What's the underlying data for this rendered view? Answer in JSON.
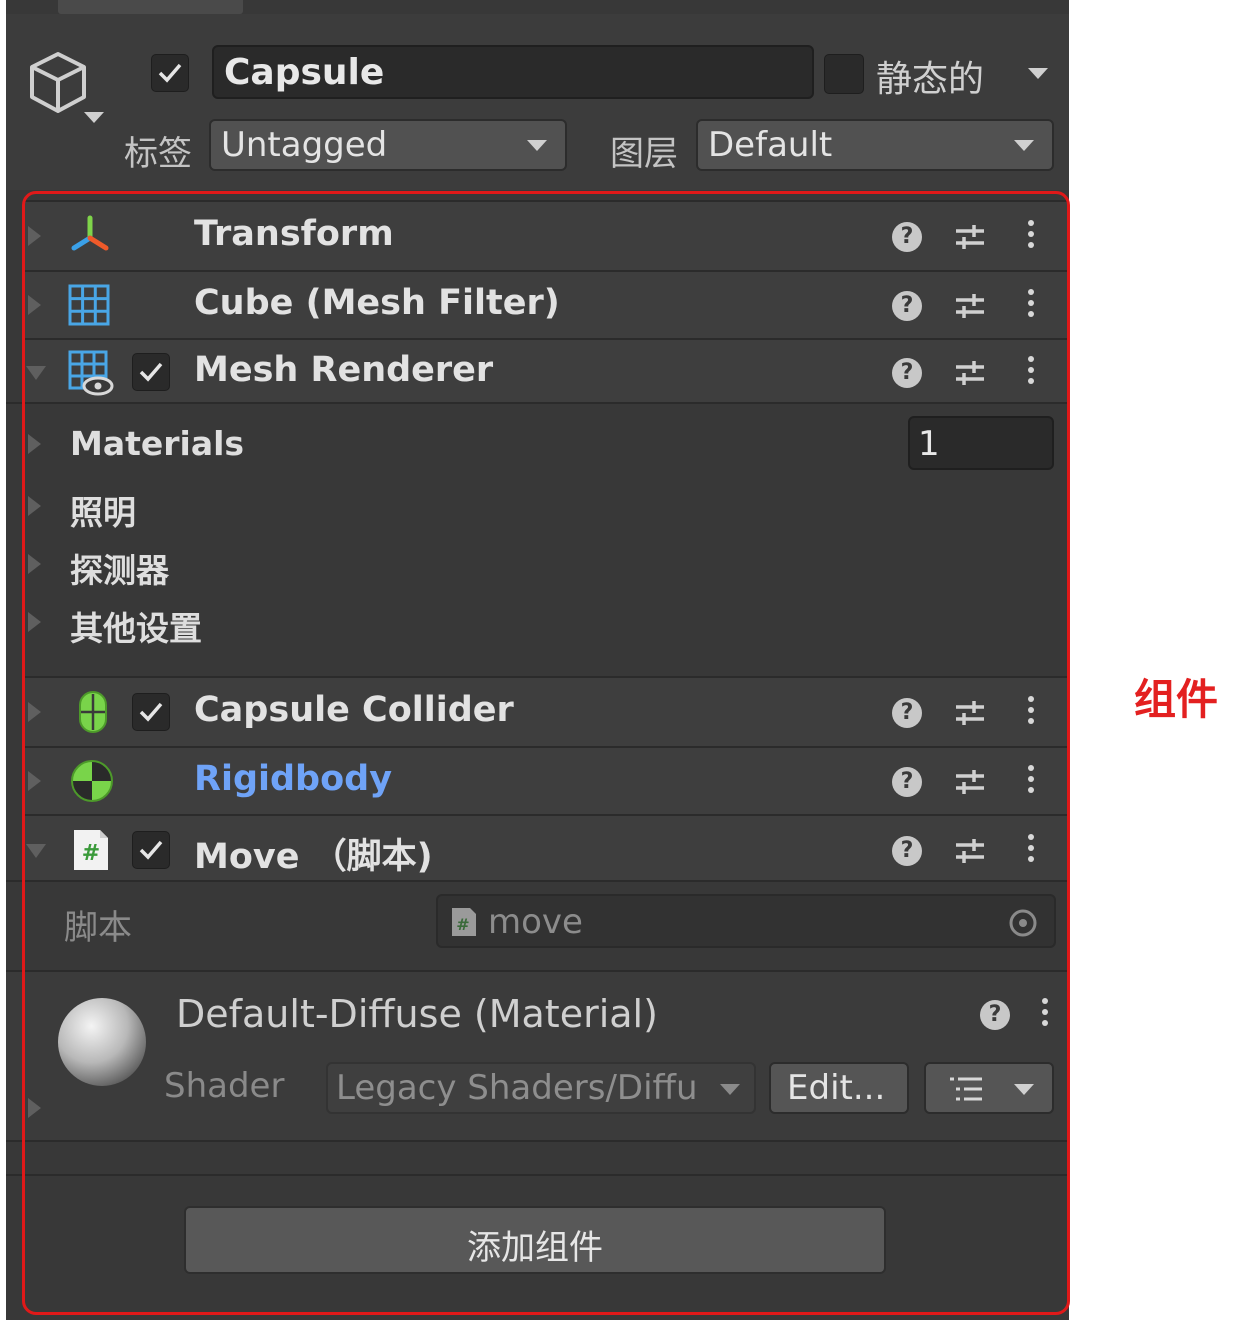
{
  "object": {
    "name": "Capsule",
    "active": true,
    "static_label": "静态的",
    "static_checked": false,
    "tag_label": "标签",
    "tag_value": "Untagged",
    "layer_label": "图层",
    "layer_value": "Default"
  },
  "components": [
    {
      "title": "Transform",
      "icon": "transform-icon",
      "has_checkbox": false,
      "expanded": false
    },
    {
      "title": "Cube (Mesh Filter)",
      "icon": "mesh-filter-icon",
      "has_checkbox": false,
      "expanded": false
    },
    {
      "title": "Mesh Renderer",
      "icon": "mesh-renderer-icon",
      "has_checkbox": true,
      "checked": true,
      "expanded": true
    },
    {
      "title": "Capsule Collider",
      "icon": "capsule-collider-icon",
      "has_checkbox": true,
      "checked": true,
      "expanded": false
    },
    {
      "title": "Rigidbody",
      "icon": "rigidbody-icon",
      "has_checkbox": false,
      "expanded": false,
      "title_color": "#6fa3f7"
    },
    {
      "title": "Move （脚本)",
      "icon": "csharp-script-icon",
      "has_checkbox": true,
      "checked": true,
      "expanded": true
    }
  ],
  "mesh_renderer": {
    "materials_label": "Materials",
    "materials_count": "1",
    "lighting_label": "照明",
    "probes_label": "探测器",
    "other_settings_label": "其他设置"
  },
  "script": {
    "label": "脚本",
    "value": "move"
  },
  "material": {
    "title": "Default-Diffuse (Material)",
    "shader_label": "Shader",
    "shader_value": "Legacy Shaders/Diffu",
    "edit_label": "Edit..."
  },
  "add_component_label": "添加组件",
  "callout_label": "组件",
  "icons": {
    "help": "?",
    "colors": {
      "accent_red": "#e01919",
      "rigidbody_blue": "#6fa3f7",
      "panel_bg": "#383838"
    }
  }
}
